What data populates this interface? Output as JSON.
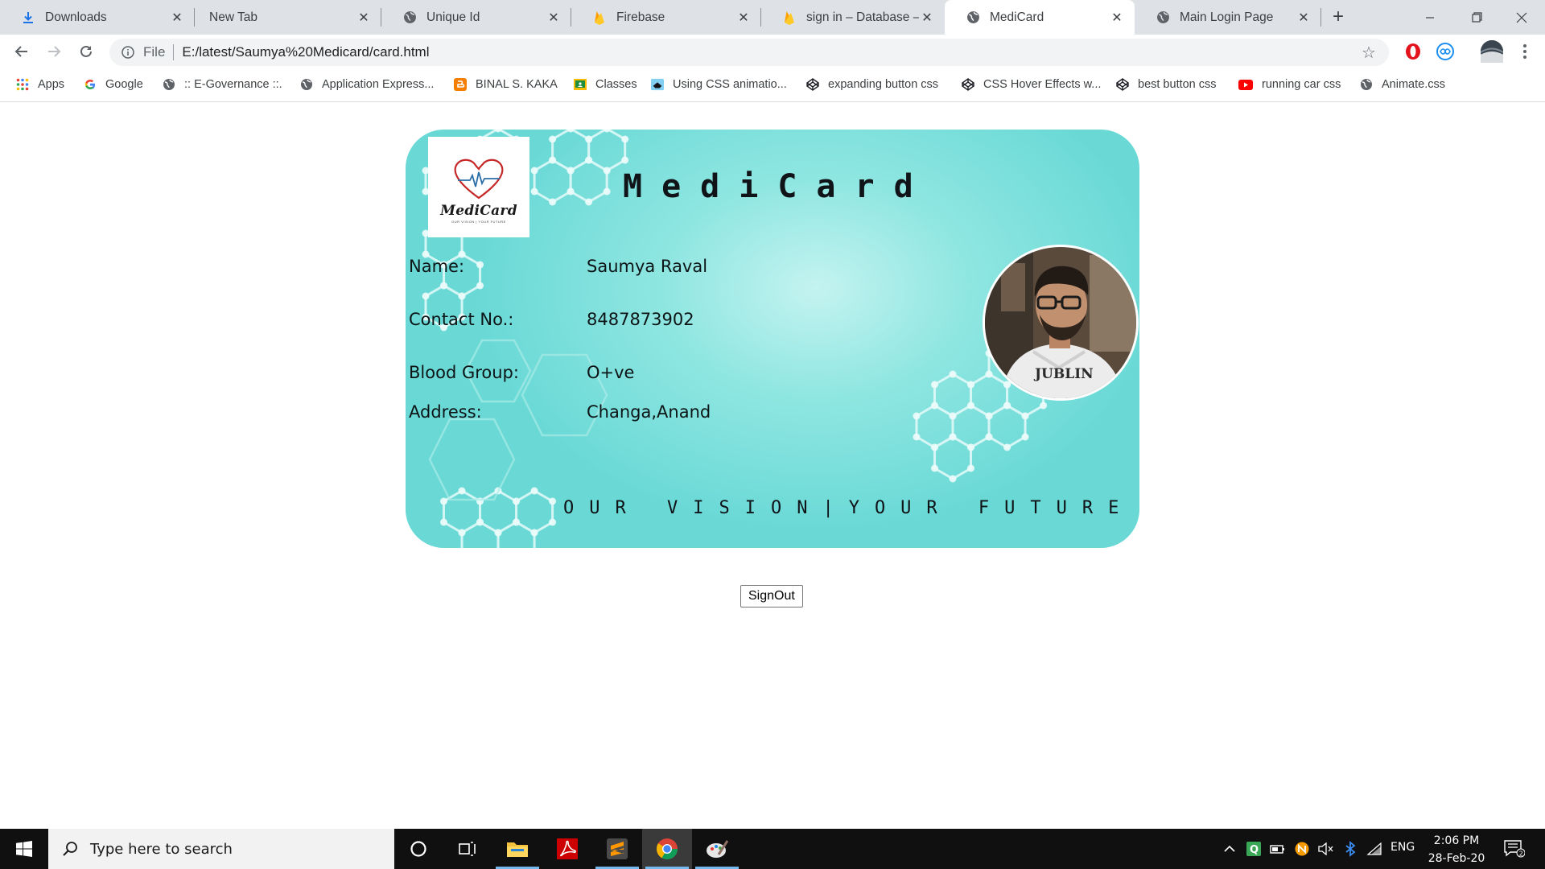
{
  "browser": {
    "tabs": [
      {
        "title": "Downloads",
        "icon": "download-icon"
      },
      {
        "title": "New Tab",
        "icon": "none"
      },
      {
        "title": "Unique Id",
        "icon": "globe-icon"
      },
      {
        "title": "Firebase",
        "icon": "firebase-icon"
      },
      {
        "title": "sign in – Database – Fir",
        "icon": "firebase-icon"
      },
      {
        "title": "MediCard",
        "icon": "globe-icon",
        "active": true
      },
      {
        "title": "Main Login Page",
        "icon": "globe-icon"
      }
    ],
    "address": {
      "scheme": "File",
      "url": "E:/latest/Saumya%20Medicard/card.html"
    },
    "bookmarks": [
      {
        "label": "Apps",
        "icon": "apps-grid-icon"
      },
      {
        "label": "Google",
        "icon": "google-icon"
      },
      {
        "label": ":: E-Governance ::.",
        "icon": "globe-icon"
      },
      {
        "label": "Application Express...",
        "icon": "globe-icon"
      },
      {
        "label": "BINAL S. KAKA",
        "icon": "blogger-icon"
      },
      {
        "label": "Classes",
        "icon": "classroom-icon"
      },
      {
        "label": "Using CSS animatio...",
        "icon": "mdn-icon"
      },
      {
        "label": "expanding button css",
        "icon": "codepen-icon"
      },
      {
        "label": "CSS Hover Effects w...",
        "icon": "codepen-icon"
      },
      {
        "label": "best button css",
        "icon": "codepen-icon"
      },
      {
        "label": "running car css",
        "icon": "youtube-icon"
      },
      {
        "label": "Animate.css",
        "icon": "globe-icon"
      }
    ]
  },
  "card": {
    "title": "MediCard",
    "logo_text": "MediCard",
    "logo_tagline": "OUR VISION | YOUR FUTURE",
    "fields": [
      {
        "label": "Name:",
        "value": "Saumya Raval"
      },
      {
        "label": "Contact No.:",
        "value": "8487873902"
      },
      {
        "label": "Blood Group:",
        "value": "O+ve"
      },
      {
        "label": "Address:",
        "value": "Changa,Anand"
      }
    ],
    "tagline": "OUR VISION|YOUR FUTURE",
    "colors": {
      "card_base": "#6ad9d6",
      "card_glow": "#c4f3f0",
      "hex_lines": "#e8fbfa"
    }
  },
  "actions": {
    "signout_label": "SignOut"
  },
  "taskbar": {
    "search_placeholder": "Type here to search",
    "language": "ENG",
    "time": "2:06 PM",
    "date": "28-Feb-20",
    "notification_count": "2"
  }
}
